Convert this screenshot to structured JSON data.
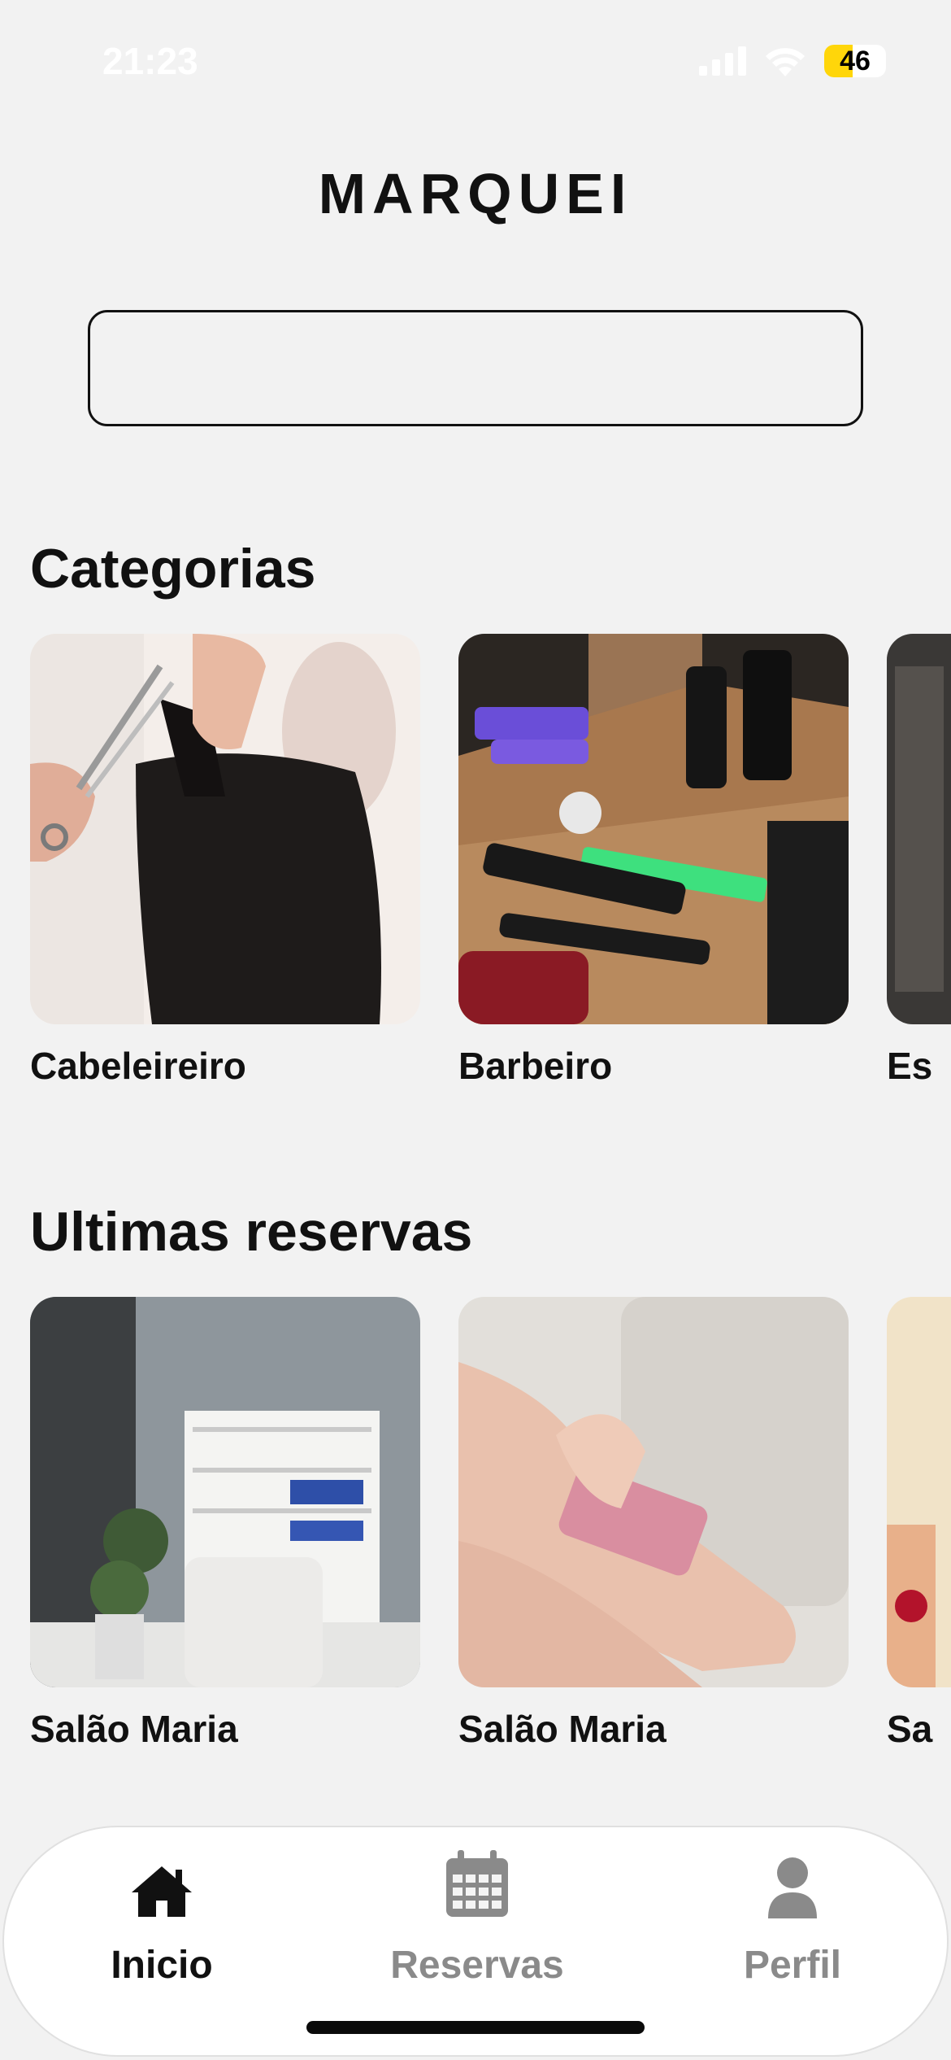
{
  "status_bar": {
    "time": "21:23",
    "battery_percent": 46,
    "battery_label": "46",
    "battery_color": "#ffd60a",
    "icons": [
      "cellular-signal-icon",
      "wifi-icon",
      "battery-icon"
    ]
  },
  "header": {
    "title": "MARQUEI"
  },
  "search": {
    "placeholder": "",
    "value": ""
  },
  "categories": {
    "title": "Categorias",
    "items": [
      {
        "label": "Cabeleireiro",
        "image": "haircut-photo"
      },
      {
        "label": "Barbeiro",
        "image": "barber-tools-photo"
      },
      {
        "label": "Es",
        "image": "partial-category-photo"
      }
    ]
  },
  "recent_bookings": {
    "title": "Ultimas reservas",
    "items": [
      {
        "label": "Salão Maria",
        "image": "salon-interior-photo"
      },
      {
        "label": "Salão Maria",
        "image": "waxing-photo"
      },
      {
        "label": "Sa",
        "image": "partial-booking-photo"
      }
    ]
  },
  "bottom_nav": {
    "items": [
      {
        "label": "Inicio",
        "icon": "home-icon",
        "active": true
      },
      {
        "label": "Reservas",
        "icon": "calendar-icon",
        "active": false
      },
      {
        "label": "Perfil",
        "icon": "user-icon",
        "active": false
      }
    ],
    "active_color": "#111111",
    "inactive_color": "#8a8a8a"
  }
}
